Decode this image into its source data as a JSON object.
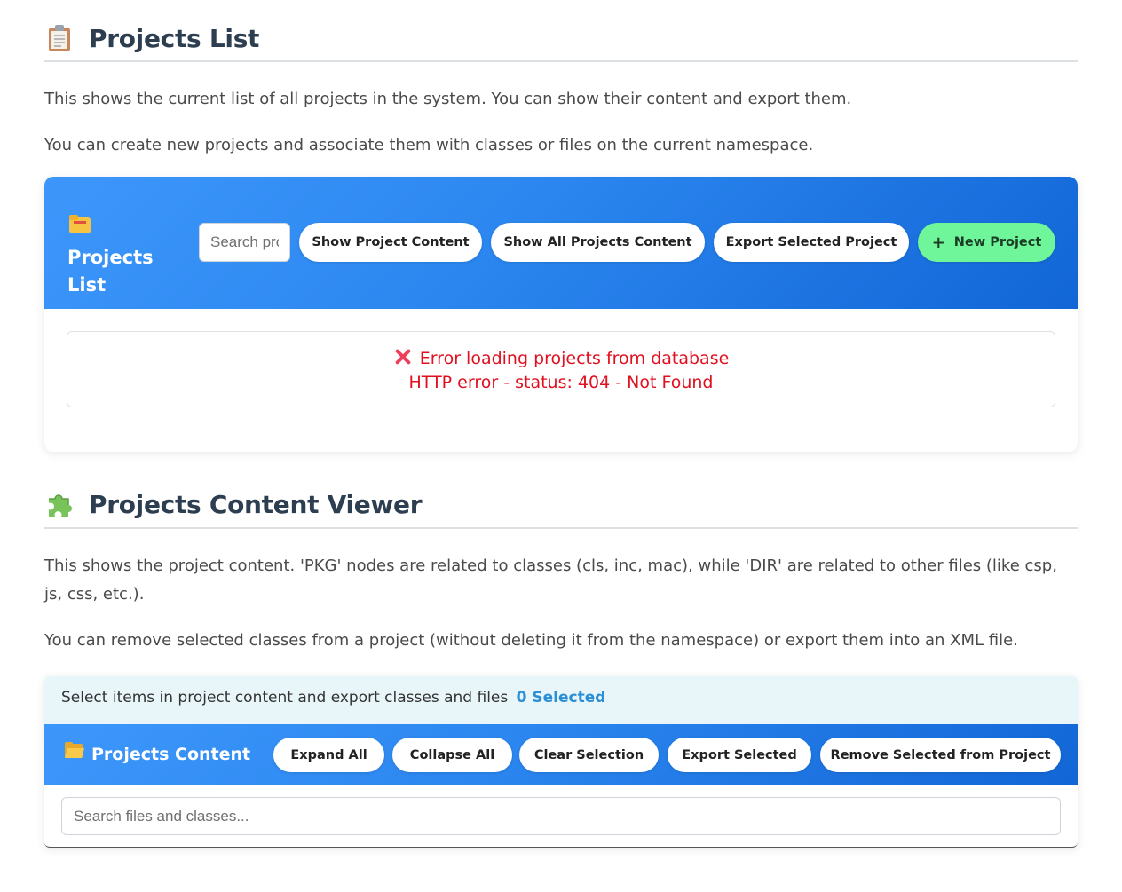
{
  "projects_list_section": {
    "title": "Projects List",
    "icon": "clipboard-icon",
    "paragraph1": "This shows the current list of all projects in the system. You can show their content and export them.",
    "paragraph2": "You can create new projects and associate them with classes or files on the current namespace."
  },
  "projects_card": {
    "header_title": "Projects List",
    "header_icon": "folder-icon",
    "search_placeholder": "Search projects...",
    "buttons": {
      "show_content": "Show Project Content",
      "show_all": "Show All Projects Content",
      "export_selected": "Export Selected Project",
      "new_project": "New Project",
      "new_project_icon": "plus-icon"
    },
    "error": {
      "line1": "Error loading projects from database",
      "line2": "HTTP error - status: 404 - Not Found",
      "icon": "cross-mark-icon",
      "color": "#e0101f"
    }
  },
  "content_viewer_section": {
    "title": "Projects Content Viewer",
    "icon": "puzzle-piece-icon",
    "paragraph1": "This shows the project content. 'PKG' nodes are related to classes (cls, inc, mac), while 'DIR' are related to other files (like csp, js, css, etc.).",
    "paragraph2": "You can remove selected classes from a project (without deleting it from the namespace) or export them into an XML file."
  },
  "content_card": {
    "selection_text": "Select items in project content and export classes and files",
    "selection_count": "0 Selected",
    "header_title": "Projects Content",
    "header_icon": "open-folder-icon",
    "buttons": {
      "expand_all": "Expand All",
      "collapse_all": "Collapse All",
      "clear_selection": "Clear Selection",
      "export_selected": "Export Selected",
      "remove_selected": "Remove Selected from Project"
    },
    "search_placeholder": "Search files and classes..."
  },
  "colors": {
    "header_gradient_start": "#3d97fb",
    "header_gradient_end": "#1266d6",
    "new_project_green": "#6ff59a",
    "selection_count_blue": "#2b8fd6",
    "title_color": "#2c3e50"
  }
}
